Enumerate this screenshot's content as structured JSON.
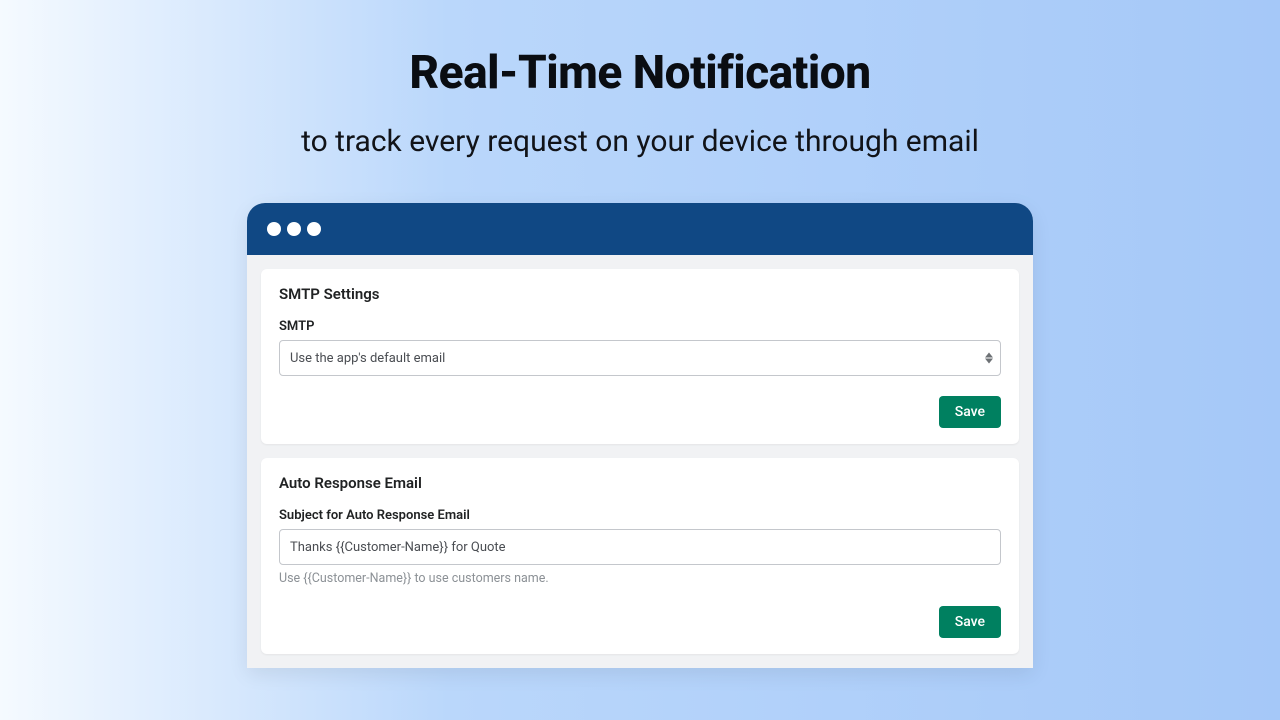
{
  "hero": {
    "title": "Real-Time Notification",
    "subtitle": "to track every request on your device through email"
  },
  "smtp_card": {
    "heading": "SMTP Settings",
    "field_label": "SMTP",
    "select_value": "Use the app's default email",
    "save_label": "Save"
  },
  "auto_card": {
    "heading": "Auto Response Email",
    "field_label": "Subject for Auto Response Email",
    "input_value": "Thanks {{Customer-Name}} for Quote",
    "help_text": "Use {{Customer-Name}} to use customers name.",
    "save_label": "Save"
  }
}
